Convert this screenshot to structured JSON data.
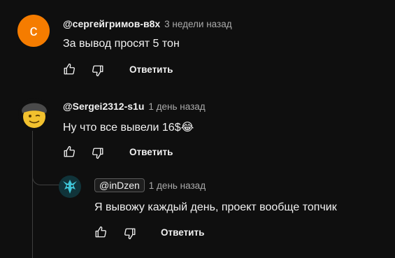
{
  "comments": [
    {
      "avatar_letter": "с",
      "author": "@сергейгримов-в8х",
      "time": "3 недели назад",
      "text": "За вывод просят 5 тон",
      "reply_label": "Ответить",
      "avatar_color": "#f57c00"
    },
    {
      "author": "@Sergei2312-s1u",
      "time": "1 день назад",
      "text": "Ну что все вывели 16$",
      "emoji": "😂",
      "reply_label": "Ответить"
    }
  ],
  "replies": [
    {
      "author": "@inDzen",
      "time": "1 день назад",
      "text": "Я вывожу каждый день, проект вообще топчик",
      "reply_label": "Ответить"
    }
  ],
  "icons": {
    "like": "thumbs-up-icon",
    "dislike": "thumbs-down-icon"
  }
}
